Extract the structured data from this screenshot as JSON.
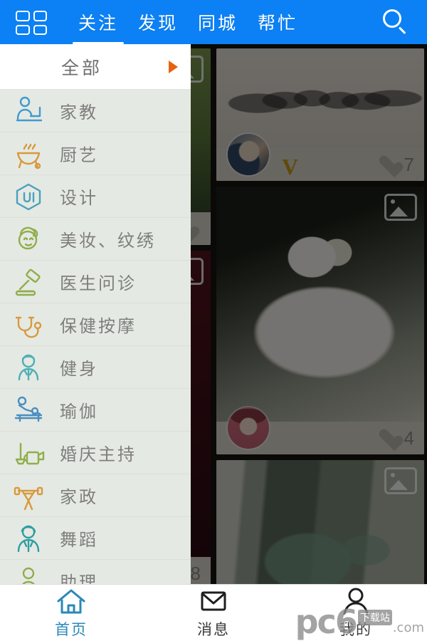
{
  "topbar": {
    "grid_icon": "grid-menu-icon",
    "search_icon": "search-icon",
    "accent_color": "#0b81f5",
    "tabs": [
      {
        "label": "关注",
        "active": true
      },
      {
        "label": "发现",
        "active": false
      },
      {
        "label": "同城",
        "active": false
      },
      {
        "label": "帮忙",
        "active": false
      }
    ]
  },
  "drawer": {
    "header": {
      "label": "全部",
      "caret_icon": "caret-right-icon",
      "caret_color": "#e8620d"
    },
    "background_color": "#e5e9e3",
    "categories": [
      {
        "label": "家教",
        "icon": "tutor-icon",
        "color": "#3f9bcd"
      },
      {
        "label": "厨艺",
        "icon": "cooking-grill-icon",
        "color": "#d79a3e"
      },
      {
        "label": "设计",
        "icon": "ui-design-icon",
        "color": "#4aa0bd"
      },
      {
        "label": "美妆、纹绣",
        "icon": "makeup-face-icon",
        "color": "#8fae4b"
      },
      {
        "label": "医生问诊",
        "icon": "gavel-icon",
        "color": "#8fae4b"
      },
      {
        "label": "保健按摩",
        "icon": "stethoscope-icon",
        "color": "#d79a3e"
      },
      {
        "label": "健身",
        "icon": "fitness-person-icon",
        "color": "#4fb0b5"
      },
      {
        "label": "瑜伽",
        "icon": "massage-table-icon",
        "color": "#4a8ec0"
      },
      {
        "label": "婚庆主持",
        "icon": "watering-can-icon",
        "color": "#8fae4b"
      },
      {
        "label": "家政",
        "icon": "barbell-icon",
        "color": "#d79a3e"
      },
      {
        "label": "舞蹈",
        "icon": "dancer-person-icon",
        "color": "#2f9fa0"
      },
      {
        "label": "助理",
        "icon": "assistant-person-icon",
        "color": "#8fae4b"
      }
    ]
  },
  "feed": {
    "left_column": [
      {
        "photo": "green-leaves-photo",
        "likes": "",
        "multi_image": true
      },
      {
        "photo": "dark-red-photo",
        "likes": "8",
        "multi_image": true
      }
    ],
    "right_column": [
      {
        "photo": "girl-group-poster-photo",
        "likes": "7",
        "multi_image": false,
        "avatar": "woman-portrait-avatar",
        "verified_badge": "V"
      },
      {
        "photo": "white-plate-food-photo",
        "likes": "4",
        "multi_image": true,
        "avatar": "cartoon-girl-avatar",
        "verified_badge": ""
      },
      {
        "photo": "green-dragon-statue-photo",
        "likes": "",
        "multi_image": true,
        "avatar": "",
        "verified_badge": ""
      }
    ]
  },
  "bottom_nav": {
    "items": [
      {
        "label": "首页",
        "icon": "home-icon",
        "active": true
      },
      {
        "label": "消息",
        "icon": "envelope-icon",
        "active": false
      },
      {
        "label": "我的",
        "icon": "person-icon",
        "active": false
      }
    ],
    "active_color": "#2b87b8"
  },
  "watermark": {
    "brand": "pc6",
    "badge": "下载站",
    "tld": ".com"
  }
}
